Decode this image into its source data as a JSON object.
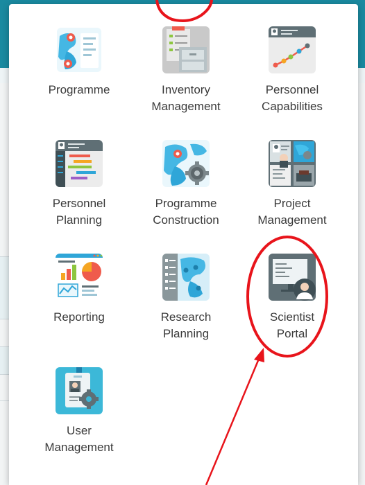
{
  "launcher": {
    "tiles": [
      {
        "id": "programme",
        "lines": [
          "Programme"
        ],
        "icon": "world-map-icon"
      },
      {
        "id": "inventory-management",
        "lines": [
          "Inventory",
          "Management"
        ],
        "icon": "file-cabinet-icon"
      },
      {
        "id": "personnel-capabilities",
        "lines": [
          "Personnel",
          "Capabilities"
        ],
        "icon": "growth-chart-icon"
      },
      {
        "id": "personnel-planning",
        "lines": [
          "Personnel",
          "Planning"
        ],
        "icon": "gantt-chart-icon"
      },
      {
        "id": "programme-construction",
        "lines": [
          "Programme",
          "Construction"
        ],
        "icon": "map-gear-icon"
      },
      {
        "id": "project-management",
        "lines": [
          "Project",
          "Management"
        ],
        "icon": "project-collage-icon"
      },
      {
        "id": "reporting",
        "lines": [
          "Reporting"
        ],
        "icon": "report-dashboard-icon"
      },
      {
        "id": "research-planning",
        "lines": [
          "Research",
          "Planning"
        ],
        "icon": "research-map-icon"
      },
      {
        "id": "scientist-portal",
        "lines": [
          "Scientist",
          "Portal"
        ],
        "icon": "scientist-monitor-icon"
      },
      {
        "id": "user-management",
        "lines": [
          "User",
          "Management"
        ],
        "icon": "id-badge-gear-icon"
      }
    ]
  },
  "annotation": {
    "color": "#e8141b",
    "highlighted_tile": "Scientist Portal"
  }
}
